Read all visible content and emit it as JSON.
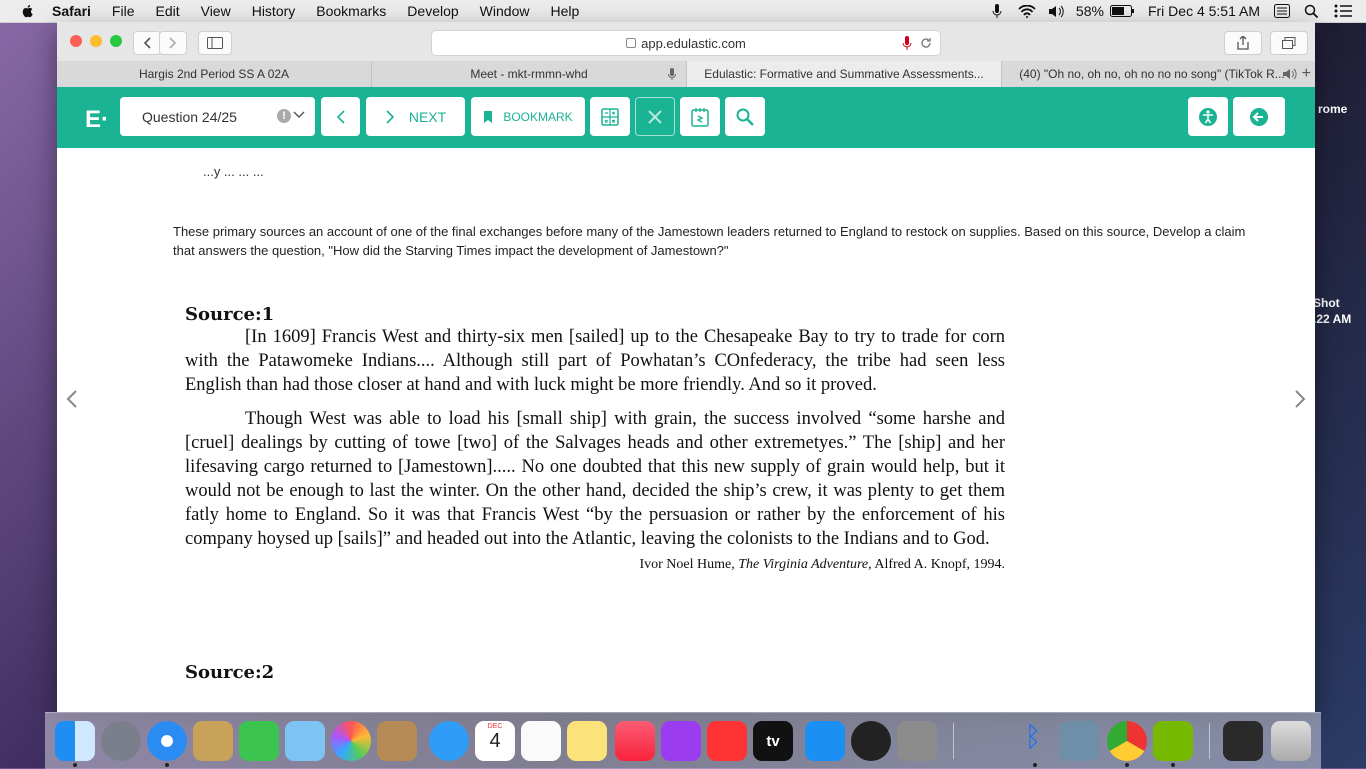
{
  "menubar": {
    "app": "Safari",
    "items": [
      "File",
      "Edit",
      "View",
      "History",
      "Bookmarks",
      "Develop",
      "Window",
      "Help"
    ],
    "battery": "58%",
    "clock": "Fri Dec 4  5:51 AM"
  },
  "browser": {
    "url": "app.edulastic.com",
    "tabs": [
      {
        "label": "Hargis 2nd Period SS A 02A"
      },
      {
        "label": "Meet - mkt-rmmn-whd"
      },
      {
        "label": "Edulastic: Formative and Summative Assessments..."
      },
      {
        "label": "(40) \"Oh no, oh no, oh no no no song\" (TikTok R..."
      }
    ]
  },
  "appbar": {
    "logo": "E·",
    "question_select": "Question 24/25",
    "info_badge": "!",
    "next_label": "NEXT",
    "bookmark_label": "BOOKMARK"
  },
  "content": {
    "cut_line": "...y                 ...                 ...              ...",
    "prompt": "These primary sources  an account of one of the final exchanges before many of the Jamestown leaders returned to England to restock on supplies. Based on this source, Develop a claim that answers the question, \"How did the Starving Times impact the development of Jamestown?\"",
    "source1_title": "Source:1",
    "source1_p1": "[In 1609] Francis West and thirty-six men [sailed] up to the Chesapeake Bay to try to trade for corn with the Patawomeke Indians.... Although still part of Powhatan’s COnfederacy, the tribe had seen less English than had those closer at hand and with luck might be more friendly. And so it proved.",
    "source1_p2": "Though West was able to load his [small ship] with grain, the success involved “some harshe and [cruel] dealings by cutting of towe [two] of the Salvages heads and other extremetyes.” The [ship] and her lifesaving cargo returned to [Jamestown]..... No one doubted that this new supply of grain would help, but it would not be enough to last the winter.  On the other hand, decided the ship’s crew, it was plenty to get them fatly home to England. So it was that Francis West “by the persuasion or rather by the enforcement of his company hoysed up [sails]” and headed out into the Atlantic, leaving the colonists to the Indians and to God.",
    "cite_author": "Ivor Noel Hume, ",
    "cite_title": "The Virginia Adventure",
    "cite_rest": ", Alfred A. Knopf, 1994.",
    "source2_title": "Source:2"
  },
  "desktop": {
    "label1": "rome",
    "label2": "Shot",
    "label3": ".22 AM"
  },
  "dock": {
    "calendar_month": "DEC",
    "calendar_day": "4",
    "tv_label": "tv"
  }
}
